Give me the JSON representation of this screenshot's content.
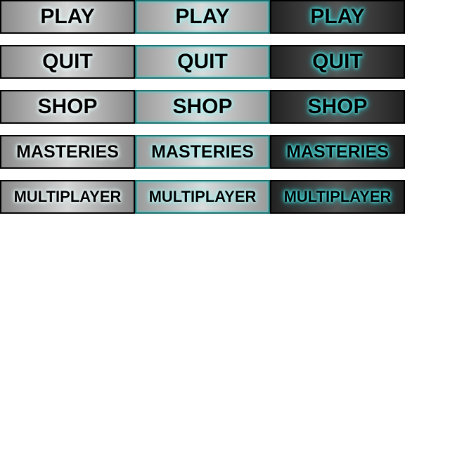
{
  "sprite_sheet": {
    "states": [
      "normal",
      "hover",
      "pressed"
    ],
    "buttons": [
      {
        "label": "PLAY"
      },
      {
        "label": "QUIT"
      },
      {
        "label": "SHOP"
      },
      {
        "label": "MASTERIES"
      },
      {
        "label": "MULTIPLAYER"
      }
    ]
  },
  "colors": {
    "background": "#ffffff",
    "border": "#000000",
    "glow": "#2fd6d6",
    "text": "#000000"
  }
}
